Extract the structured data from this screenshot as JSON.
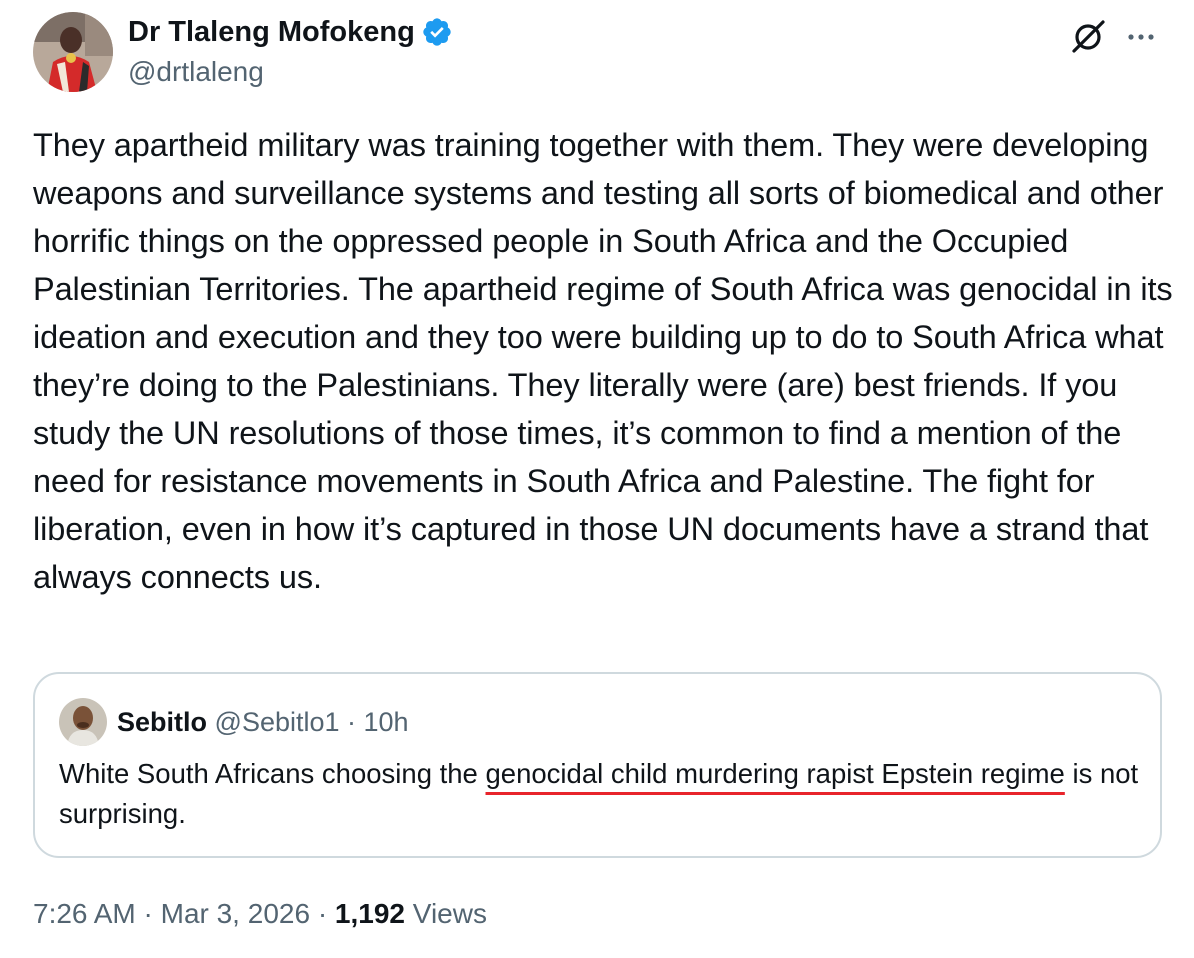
{
  "author": {
    "name": "Dr Tlaleng Mofokeng",
    "handle": "@drtlaleng",
    "verified": true
  },
  "icons": {
    "verified": "verified-badge-icon",
    "grok": "grok-icon",
    "more": "more-options-icon"
  },
  "tweet": {
    "text": "They apartheid military was training together with them. They were developing weapons and surveillance systems and testing all sorts of biomedical and other horrific things on the oppressed people in South Africa and the Occupied Palestinian Territories. The apartheid regime of South Africa was genocidal in its ideation and execution and they too were building up to do to South Africa what they’re doing to the Palestinians. They literally were (are) best friends. If you study the UN resolutions of those times, it’s common to find a mention of the need for resistance movements in South Africa and Palestine. The fight for liberation, even in how it’s captured in those UN documents have a strand that always connects us."
  },
  "quote": {
    "name": "Sebitlo",
    "meta": "@Sebitlo1 · 10h",
    "text_before": "White South Africans choosing the ",
    "text_highlight": "genocidal child murdering rapist Epstein regime",
    "text_after": " is not surprising.",
    "highlight_color": "#e8242b"
  },
  "footer": {
    "time_date": "7:26 AM · Mar 3, 2026 · ",
    "views_count": "1,192",
    "views_label": "Views"
  },
  "colors": {
    "primary_text": "#0f1419",
    "secondary_text": "#536471",
    "border": "#cfd9de",
    "verified_blue": "#1d9bf0"
  }
}
